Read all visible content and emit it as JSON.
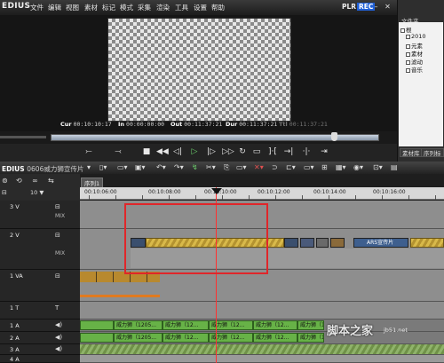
{
  "app": {
    "name": "EDIUS",
    "menus": [
      "文件",
      "编辑",
      "视图",
      "素材",
      "标记",
      "模式",
      "采集",
      "渲染",
      "工具",
      "设置",
      "帮助"
    ],
    "plr": "PLR",
    "rec": "REC"
  },
  "timecodes": {
    "cur_label": "Cur",
    "cur": "00:10:10:17",
    "in_label": "In",
    "in": "00:00:00:00",
    "out_label": "Out",
    "out": "00:11:37:21",
    "dur_label": "Dur",
    "dur": "00:11:37:21",
    "ttl_label": "Ttl",
    "ttl": "00:11:37:21"
  },
  "bin": {
    "title": "文件夹",
    "tree": [
      "根",
      "2010",
      "元素",
      "素材",
      "滤动",
      "音乐"
    ],
    "tabs": [
      "素材库",
      "序列标"
    ]
  },
  "timeline": {
    "app_label": "EDIUS",
    "project": "0606威力狮宣传片",
    "sequence_tab": "序列1",
    "ruler": [
      "00:10:06:00",
      "00:10:08:00",
      "00:10:10:00",
      "00:10:12:00",
      "00:10:14:00",
      "00:10:16:00"
    ],
    "track_heights": [
      "10 ▼"
    ],
    "tracks": [
      {
        "name": "3 V"
      },
      {
        "name": "2 V"
      },
      {
        "name": "1 VA"
      },
      {
        "name": "1 T"
      },
      {
        "name": "1 A"
      },
      {
        "name": "2 A"
      },
      {
        "name": "3 A"
      },
      {
        "name": "4 A"
      }
    ],
    "v2_clip_label": "ARS宣传片",
    "audio_clips_a1": [
      "威力狮（1205...",
      "威力狮（12...",
      "威力狮（12...",
      "威力狮（12...",
      "威力狮（12..."
    ],
    "audio_clips_a2": [
      "威力狮（1205...",
      "威力狮（12...",
      "威力狮（12...",
      "威力狮（12...",
      "威力狮（12..."
    ]
  },
  "watermark": {
    "main": "脚本之家",
    "url": "jb51.net"
  },
  "colors": {
    "rec": "#1f5fd6",
    "playhead": "#ff3030",
    "selection": "#e0262a",
    "audio_clip": "#67b247",
    "title_clip": "#d8b94a"
  }
}
